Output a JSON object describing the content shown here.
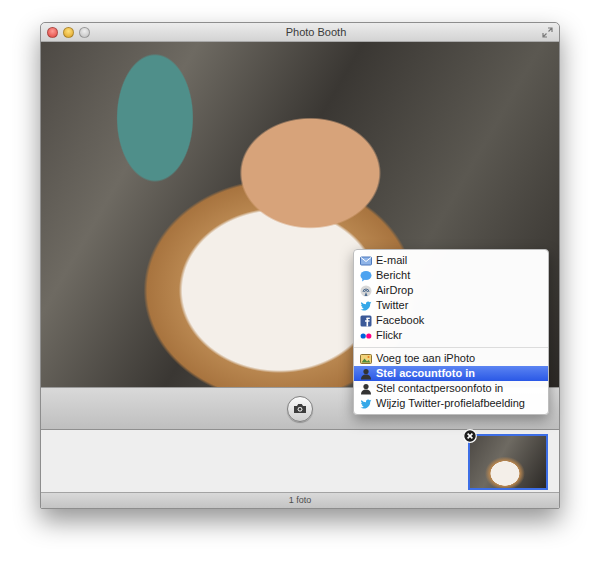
{
  "window": {
    "title": "Photo Booth"
  },
  "menu": {
    "groups": [
      {
        "items": [
          {
            "label": "E-mail",
            "selected": false
          },
          {
            "label": "Bericht",
            "selected": false
          },
          {
            "label": "AirDrop",
            "selected": false
          },
          {
            "label": "Twitter",
            "selected": false
          },
          {
            "label": "Facebook",
            "selected": false
          },
          {
            "label": "Flickr",
            "selected": false
          }
        ]
      },
      {
        "items": [
          {
            "label": "Voeg toe aan iPhoto",
            "selected": false
          },
          {
            "label": "Stel accountfoto in",
            "selected": true
          },
          {
            "label": "Stel contactpersoonfoto in",
            "selected": false
          },
          {
            "label": "Wijzig Twitter-profielafbeelding",
            "selected": false
          }
        ]
      }
    ]
  },
  "filmstrip": {
    "photos": [
      {
        "selected": true
      }
    ]
  },
  "status_bar": {
    "text": "1 foto"
  }
}
